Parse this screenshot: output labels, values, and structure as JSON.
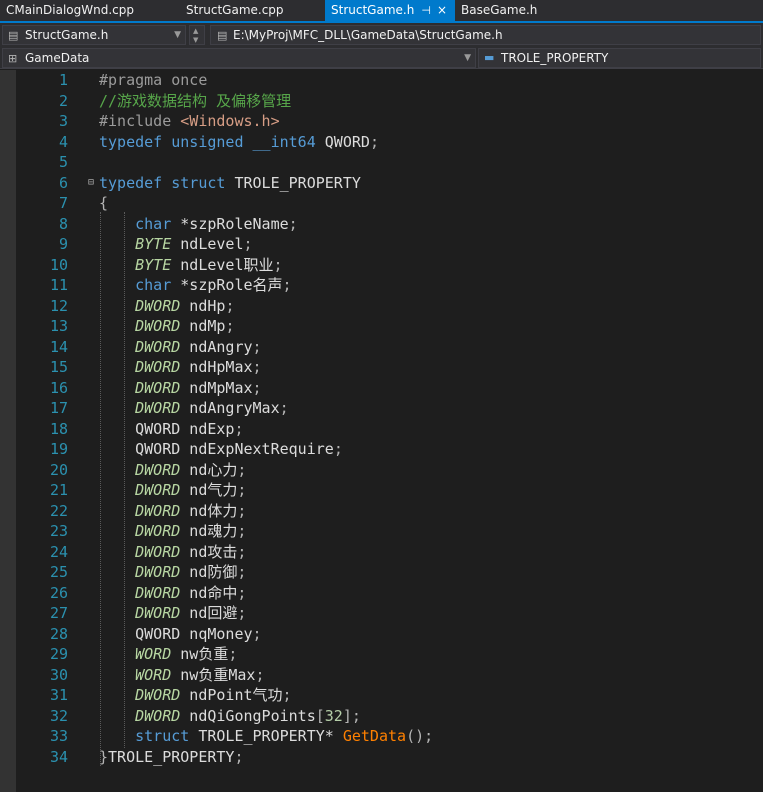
{
  "tabs": [
    {
      "label": "CMainDialogWnd.cpp",
      "active": false
    },
    {
      "label": "StructGame.cpp",
      "active": false
    },
    {
      "label": "StructGame.h",
      "active": true
    },
    {
      "label": "BaseGame.h",
      "active": false
    }
  ],
  "tab_pin_glyph": "⊣",
  "tab_close_glyph": "×",
  "nav": {
    "file_combo": "StructGame.h",
    "path": "E:\\MyProj\\MFC_DLL\\GameData\\StructGame.h",
    "scope_left": "GameData",
    "scope_right": "TROLE_PROPERTY"
  },
  "colors": {
    "accent": "#007acc",
    "keyword": "#569cd6",
    "comment": "#57a64a",
    "string": "#d69d85",
    "macro": "#b8d7a3",
    "function": "#ff8000",
    "line_number": "#2b91af"
  },
  "code": [
    [
      [
        "pp",
        "#pragma once"
      ]
    ],
    [
      [
        "cm",
        "//游戏数据结构 及偏移管理"
      ]
    ],
    [
      [
        "pp",
        "#include "
      ],
      [
        "st",
        "<Windows.h>"
      ]
    ],
    [
      [
        "kw",
        "typedef"
      ],
      [
        "id",
        " "
      ],
      [
        "kw",
        "unsigned"
      ],
      [
        "id",
        " "
      ],
      [
        "kw",
        "__int64"
      ],
      [
        "id",
        " QWORD"
      ],
      [
        "pu",
        ";"
      ]
    ],
    [],
    [
      [
        "kw",
        "typedef"
      ],
      [
        "id",
        " "
      ],
      [
        "kw",
        "struct"
      ],
      [
        "id",
        " TROLE_PROPERTY"
      ]
    ],
    [
      [
        "pu",
        "{"
      ]
    ],
    [
      [
        "id",
        "    "
      ],
      [
        "kw",
        "char"
      ],
      [
        "id",
        " *szpRoleName"
      ],
      [
        "pu",
        ";"
      ]
    ],
    [
      [
        "id",
        "    "
      ],
      [
        "mac",
        "BYTE"
      ],
      [
        "id",
        " ndLevel"
      ],
      [
        "pu",
        ";"
      ]
    ],
    [
      [
        "id",
        "    "
      ],
      [
        "mac",
        "BYTE"
      ],
      [
        "id",
        " ndLevel职业"
      ],
      [
        "pu",
        ";"
      ]
    ],
    [
      [
        "id",
        "    "
      ],
      [
        "kw",
        "char"
      ],
      [
        "id",
        " *szpRole名声"
      ],
      [
        "pu",
        ";"
      ]
    ],
    [
      [
        "id",
        "    "
      ],
      [
        "mac",
        "DWORD"
      ],
      [
        "id",
        " ndHp"
      ],
      [
        "pu",
        ";"
      ]
    ],
    [
      [
        "id",
        "    "
      ],
      [
        "mac",
        "DWORD"
      ],
      [
        "id",
        " ndMp"
      ],
      [
        "pu",
        ";"
      ]
    ],
    [
      [
        "id",
        "    "
      ],
      [
        "mac",
        "DWORD"
      ],
      [
        "id",
        " ndAngry"
      ],
      [
        "pu",
        ";"
      ]
    ],
    [
      [
        "id",
        "    "
      ],
      [
        "mac",
        "DWORD"
      ],
      [
        "id",
        " ndHpMax"
      ],
      [
        "pu",
        ";"
      ]
    ],
    [
      [
        "id",
        "    "
      ],
      [
        "mac",
        "DWORD"
      ],
      [
        "id",
        " ndMpMax"
      ],
      [
        "pu",
        ";"
      ]
    ],
    [
      [
        "id",
        "    "
      ],
      [
        "mac",
        "DWORD"
      ],
      [
        "id",
        " ndAngryMax"
      ],
      [
        "pu",
        ";"
      ]
    ],
    [
      [
        "id",
        "    QWORD ndExp"
      ],
      [
        "pu",
        ";"
      ]
    ],
    [
      [
        "id",
        "    QWORD ndExpNextRequire"
      ],
      [
        "pu",
        ";"
      ]
    ],
    [
      [
        "id",
        "    "
      ],
      [
        "mac",
        "DWORD"
      ],
      [
        "id",
        " nd心力"
      ],
      [
        "pu",
        ";"
      ]
    ],
    [
      [
        "id",
        "    "
      ],
      [
        "mac",
        "DWORD"
      ],
      [
        "id",
        " nd气力"
      ],
      [
        "pu",
        ";"
      ]
    ],
    [
      [
        "id",
        "    "
      ],
      [
        "mac",
        "DWORD"
      ],
      [
        "id",
        " nd体力"
      ],
      [
        "pu",
        ";"
      ]
    ],
    [
      [
        "id",
        "    "
      ],
      [
        "mac",
        "DWORD"
      ],
      [
        "id",
        " nd魂力"
      ],
      [
        "pu",
        ";"
      ]
    ],
    [
      [
        "id",
        "    "
      ],
      [
        "mac",
        "DWORD"
      ],
      [
        "id",
        " nd攻击"
      ],
      [
        "pu",
        ";"
      ]
    ],
    [
      [
        "id",
        "    "
      ],
      [
        "mac",
        "DWORD"
      ],
      [
        "id",
        " nd防御"
      ],
      [
        "pu",
        ";"
      ]
    ],
    [
      [
        "id",
        "    "
      ],
      [
        "mac",
        "DWORD"
      ],
      [
        "id",
        " nd命中"
      ],
      [
        "pu",
        ";"
      ]
    ],
    [
      [
        "id",
        "    "
      ],
      [
        "mac",
        "DWORD"
      ],
      [
        "id",
        " nd回避"
      ],
      [
        "pu",
        ";"
      ]
    ],
    [
      [
        "id",
        "    QWORD nqMoney"
      ],
      [
        "pu",
        ";"
      ]
    ],
    [
      [
        "id",
        "    "
      ],
      [
        "mac",
        "WORD"
      ],
      [
        "id",
        " nw负重"
      ],
      [
        "pu",
        ";"
      ]
    ],
    [
      [
        "id",
        "    "
      ],
      [
        "mac",
        "WORD"
      ],
      [
        "id",
        " nw负重Max"
      ],
      [
        "pu",
        ";"
      ]
    ],
    [
      [
        "id",
        "    "
      ],
      [
        "mac",
        "DWORD"
      ],
      [
        "id",
        " ndPoint气功"
      ],
      [
        "pu",
        ";"
      ]
    ],
    [
      [
        "id",
        "    "
      ],
      [
        "mac",
        "DWORD"
      ],
      [
        "id",
        " ndQiGongPoints"
      ],
      [
        "pu",
        "["
      ],
      [
        "num",
        "32"
      ],
      [
        "pu",
        "];"
      ]
    ],
    [
      [
        "id",
        "    "
      ],
      [
        "kw",
        "struct"
      ],
      [
        "id",
        " TROLE_PROPERTY* "
      ],
      [
        "fn",
        "GetData"
      ],
      [
        "pu",
        "();"
      ]
    ],
    [
      [
        "pu",
        "}"
      ],
      [
        "id",
        "TROLE_PROPERTY"
      ],
      [
        "pu",
        ";"
      ]
    ]
  ]
}
